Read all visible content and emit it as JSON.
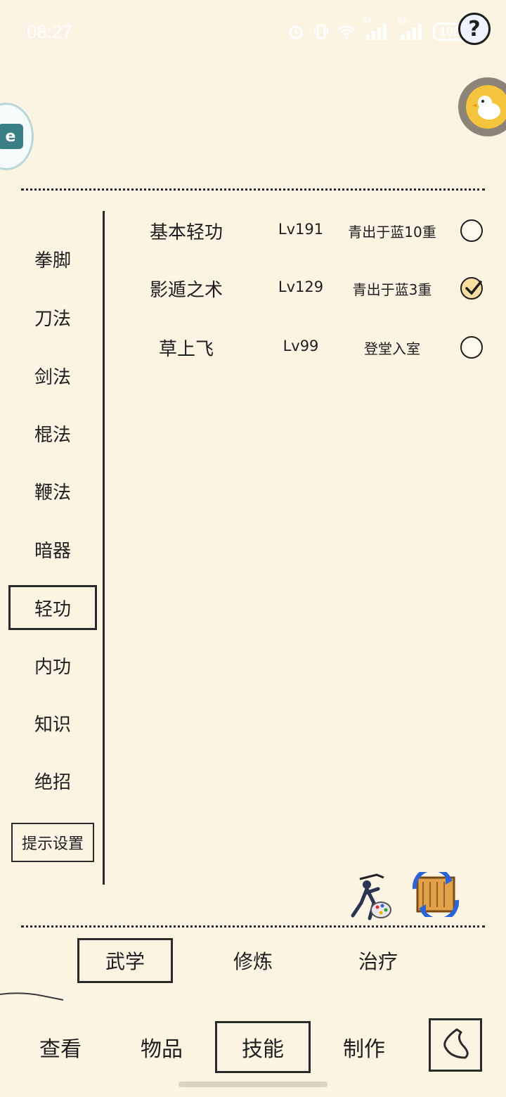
{
  "status_bar": {
    "time": "08:27",
    "battery": "100",
    "signal_label_1": "5A",
    "signal_label_2": "5A"
  },
  "help": {
    "label": "?"
  },
  "floating_left": {
    "label": "e"
  },
  "categories": [
    {
      "label": "拳脚",
      "active": false
    },
    {
      "label": "刀法",
      "active": false
    },
    {
      "label": "剑法",
      "active": false
    },
    {
      "label": "棍法",
      "active": false
    },
    {
      "label": "鞭法",
      "active": false
    },
    {
      "label": "暗器",
      "active": false
    },
    {
      "label": "轻功",
      "active": true
    },
    {
      "label": "内功",
      "active": false
    },
    {
      "label": "知识",
      "active": false
    },
    {
      "label": "绝招",
      "active": false
    }
  ],
  "hint_settings_label": "提示设置",
  "skills": [
    {
      "name": "基本轻功",
      "level": "Lv191",
      "rank": "青出于蓝10重",
      "equipped": false
    },
    {
      "name": "影遁之术",
      "level": "Lv129",
      "rank": "青出于蓝3重",
      "equipped": true
    },
    {
      "name": "草上飞",
      "level": "Lv99",
      "rank": "登堂入室",
      "equipped": false
    }
  ],
  "sub_tabs": [
    {
      "label": "武学",
      "active": true
    },
    {
      "label": "修炼",
      "active": false
    },
    {
      "label": "治疗",
      "active": false
    }
  ],
  "nav_tabs": [
    {
      "label": "查看",
      "active": false
    },
    {
      "label": "物品",
      "active": false
    },
    {
      "label": "技能",
      "active": true
    },
    {
      "label": "制作",
      "active": false
    }
  ],
  "icons": {
    "alarm": "alarm-icon",
    "vibrate": "vibrate-icon",
    "wifi": "wifi-icon",
    "signal": "signal-icon",
    "warrior": "warrior-palette-icon",
    "swap": "swap-scroll-icon",
    "back": "back-arrow-icon"
  }
}
